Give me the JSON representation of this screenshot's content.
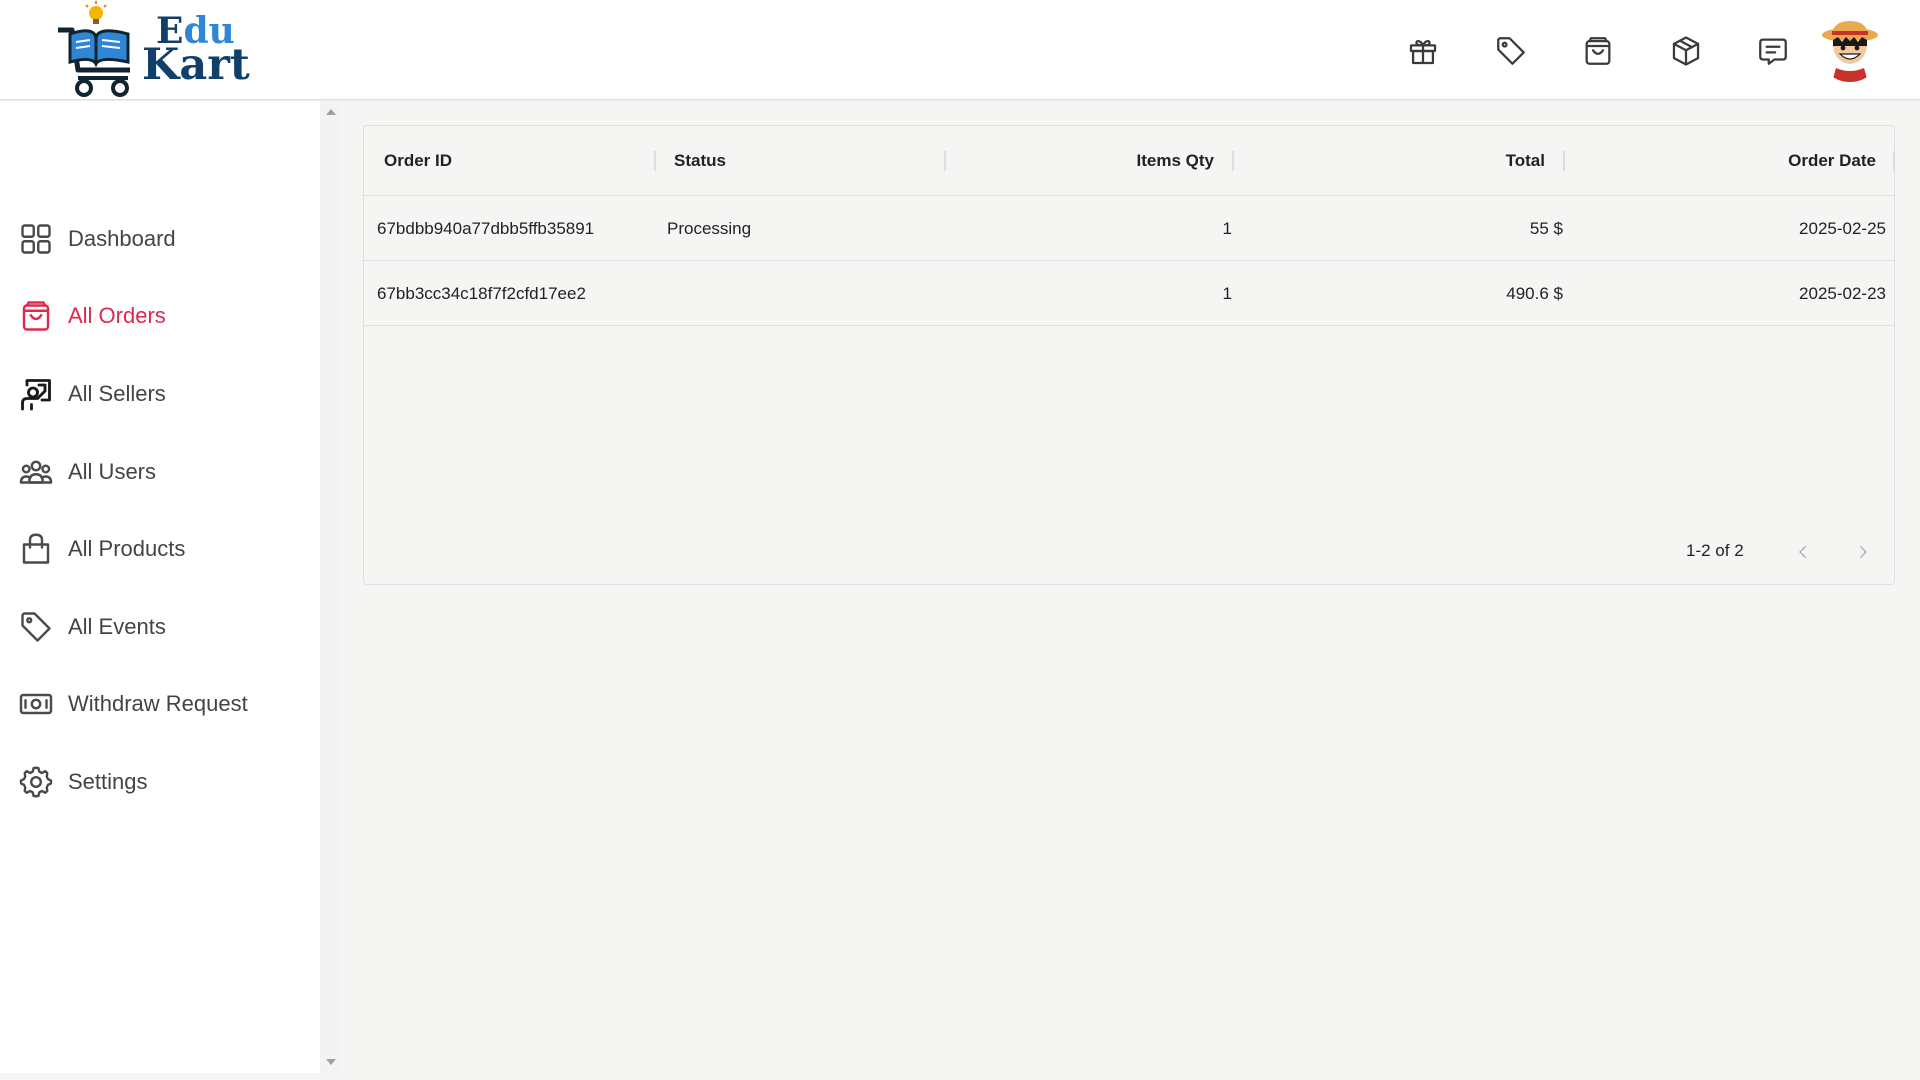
{
  "brand": {
    "line1_a": "E",
    "line1_b": "du",
    "line2": "Kart"
  },
  "header_icons": [
    {
      "icon": "gift-icon"
    },
    {
      "icon": "tag-icon"
    },
    {
      "icon": "shopping-bag-icon"
    },
    {
      "icon": "package-icon"
    },
    {
      "icon": "message-icon"
    }
  ],
  "sidebar": {
    "items": [
      {
        "label": "Dashboard",
        "icon": "dashboard-grid-icon"
      },
      {
        "label": "All Orders",
        "icon": "shopping-bag-icon",
        "active": true
      },
      {
        "label": "All Sellers",
        "icon": "seller-icon"
      },
      {
        "label": "All Users",
        "icon": "users-icon"
      },
      {
        "label": "All Products",
        "icon": "products-bag-icon"
      },
      {
        "label": "All Events",
        "icon": "tag-icon"
      },
      {
        "label": "Withdraw Request",
        "icon": "money-icon"
      },
      {
        "label": "Settings",
        "icon": "gear-icon"
      }
    ],
    "active_color": "#e0284f"
  },
  "orders_table": {
    "columns": [
      "Order ID",
      "Status",
      "Items Qty",
      "Total",
      "Order Date"
    ],
    "rows": [
      {
        "order_id": "67bdbb940a77dbb5ffb35891",
        "status": "Processing",
        "items_qty": "1",
        "total": "55 $",
        "order_date": "2025-02-25"
      },
      {
        "order_id": "67bb3cc34c18f7f2cfd17ee2",
        "status": "",
        "items_qty": "1",
        "total": "490.6 $",
        "order_date": "2025-02-23"
      }
    ],
    "pagination": {
      "range": "1-2 of 2"
    }
  }
}
